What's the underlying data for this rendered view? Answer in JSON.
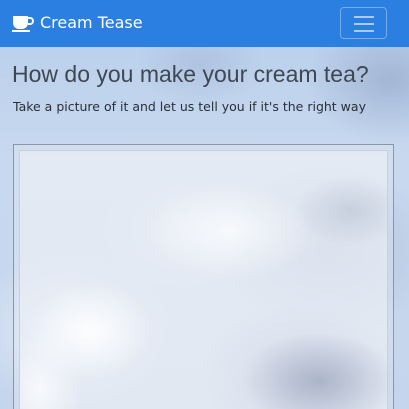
{
  "navbar": {
    "brand_icon": "cup-icon",
    "brand_text": "Cream Tease",
    "menu_icon": "hamburger-menu-icon",
    "background_color": "#2b7fe0"
  },
  "main": {
    "heading": "How do you make your cream tea?",
    "subtitle": "Take a picture of it and let us tell you if it's the right way"
  }
}
